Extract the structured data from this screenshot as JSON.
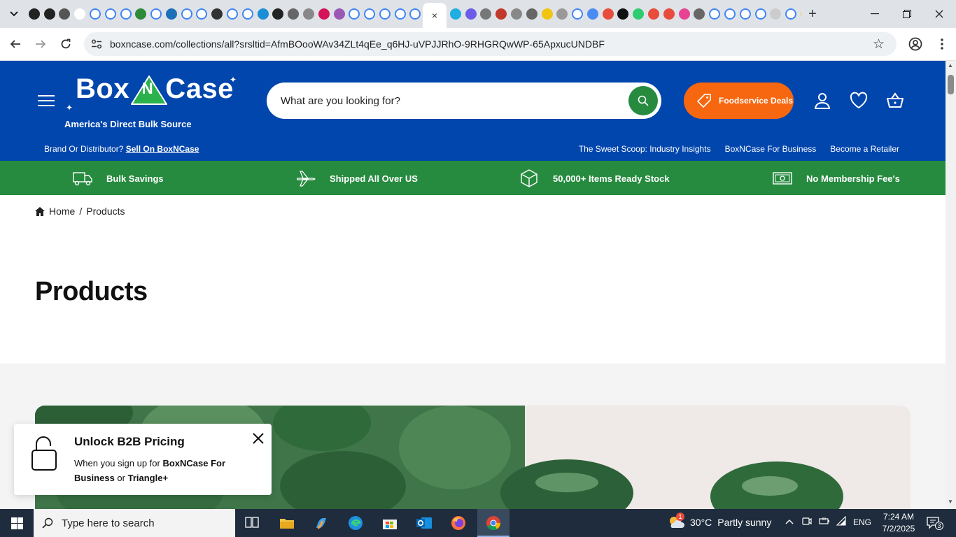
{
  "browser": {
    "favicon_colors": [
      "#222",
      "#222",
      "#555",
      "#fff",
      "#4285f4",
      "#4285f4",
      "#4285f4",
      "#2d8a39",
      "#4285f4",
      "#1d6fb8",
      "#4285f4",
      "#4285f4",
      "#333",
      "#4285f4",
      "#4285f4",
      "#1b8ed8",
      "#222",
      "#666",
      "#888",
      "#d4145a",
      "#9b59b6",
      "#4285f4",
      "#4285f4",
      "#4285f4",
      "#4285f4",
      "#4285f4"
    ],
    "favicon_colors_right": [
      "#1eaee0",
      "#6c5ce7",
      "#777",
      "#c0392b",
      "#888",
      "#666",
      "#f1c40f",
      "#999",
      "#4285f4",
      "#4b8bf4",
      "#e74c3c",
      "#111",
      "#2ecc71",
      "#e74c3c",
      "#e74c3c",
      "#e84393",
      "#666",
      "#4285f4",
      "#4285f4",
      "#4285f4",
      "#4285f4",
      "#ccc",
      "#4285f4",
      "#f1c40f"
    ],
    "active_tab_close": "×",
    "url": "boxncase.com/collections/all?srsltid=AfmBOooWAv34ZLt4qEe_q6HJ-uVPJJRhO-9RHGRQwWP-65ApxucUNDBF"
  },
  "header": {
    "logo_text": "Box N Case",
    "logo_tagline": "America's Direct Bulk Source",
    "search_placeholder": "What are you looking for?",
    "deals_label": "Foodservice Deals",
    "brand_prompt": "Brand Or Distributor?",
    "brand_link": "Sell On BoxNCase",
    "nav_links": [
      "The Sweet Scoop: Industry Insights",
      "BoxNCase For Business",
      "Become a Retailer"
    ],
    "accent_blue": "#0046ad",
    "accent_green": "#268a3f",
    "accent_orange": "#f7670f"
  },
  "benefits": [
    "Bulk Savings",
    "Shipped All Over US",
    "50,000+ Items Ready Stock",
    "No Membership Fee's"
  ],
  "breadcrumb": {
    "home": "Home",
    "separator": "/",
    "current": "Products"
  },
  "page_title": "Products",
  "popup": {
    "title": "Unlock B2B Pricing",
    "body_prefix": "When you sign up for ",
    "body_bold1": "BoxNCase For Business",
    "body_mid": " or ",
    "body_bold2": "Triangle+"
  },
  "taskbar": {
    "search_placeholder": "Type here to search",
    "weather_temp": "30°C",
    "weather_desc": "Partly sunny",
    "weather_badge": "1",
    "language": "ENG",
    "time": "7:24 AM",
    "date": "7/2/2025",
    "notification_count": "3"
  }
}
